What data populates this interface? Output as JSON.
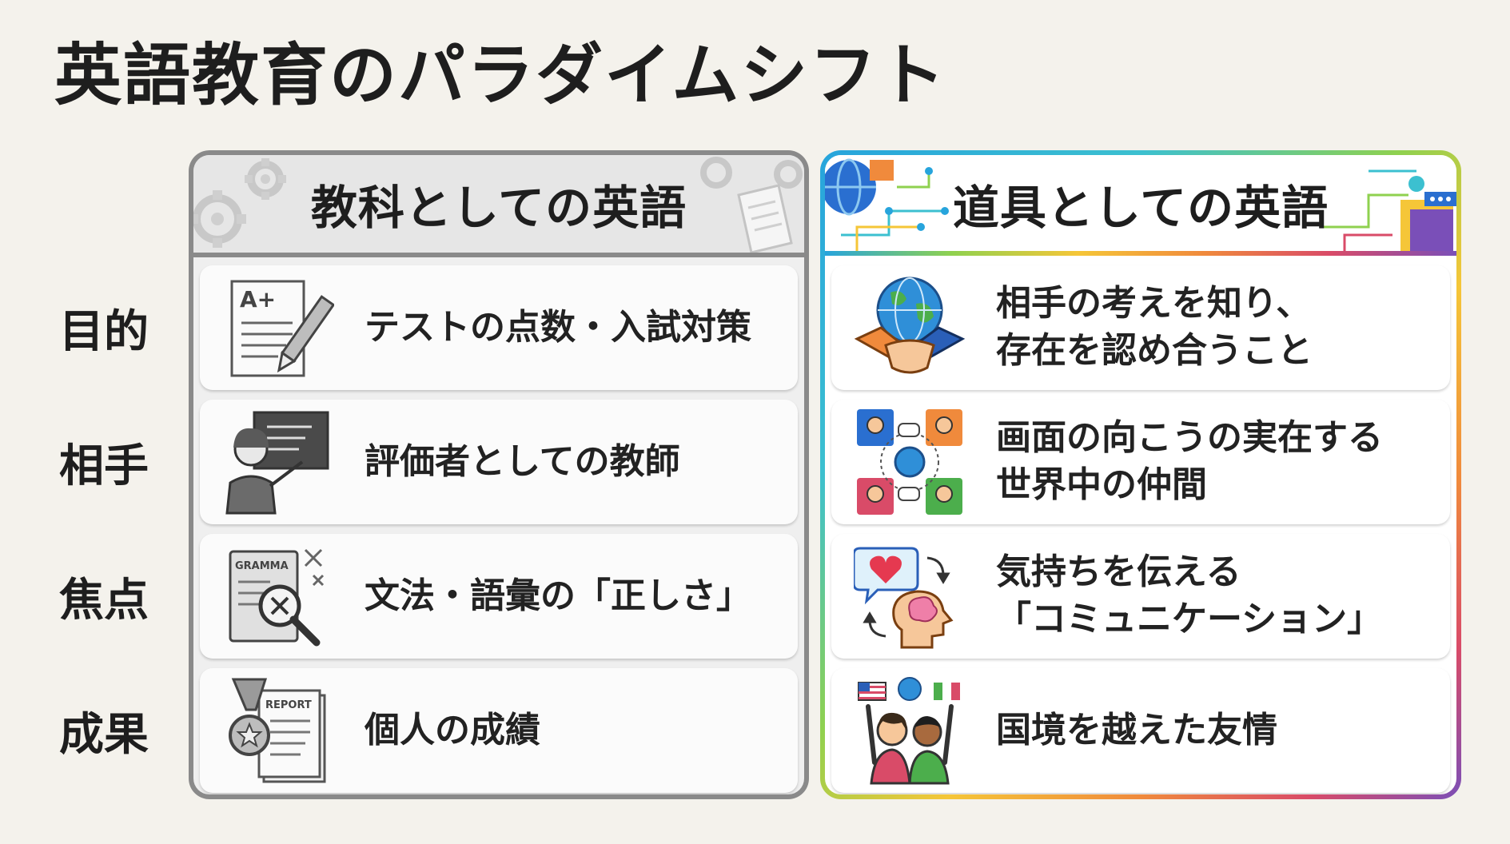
{
  "title": "英語教育のパラダイムシフト",
  "rows": [
    "目的",
    "相手",
    "焦点",
    "成果"
  ],
  "left": {
    "heading": "教科としての英語",
    "items": [
      {
        "text": [
          "テストの点数・入試対策"
        ],
        "icon": "graded-test-pencil-icon",
        "icon_text": "A+"
      },
      {
        "text": [
          "評価者としての教師"
        ],
        "icon": "teacher-blackboard-icon"
      },
      {
        "text": [
          "文法・語彙の「正しさ」"
        ],
        "icon": "grammar-book-magnifier-icon",
        "icon_text": "GRAMMA"
      },
      {
        "text": [
          "個人の成績"
        ],
        "icon": "medal-report-icon",
        "icon_text": "REPORT"
      }
    ]
  },
  "right": {
    "heading": "道具としての英語",
    "items": [
      {
        "text": [
          "相手の考えを知り、",
          "存在を認め合うこと"
        ],
        "icon": "globe-handshake-icon"
      },
      {
        "text": [
          "画面の向こうの実在する",
          "世界中の仲間"
        ],
        "icon": "global-video-chat-icon"
      },
      {
        "text": [
          "気持ちを伝える",
          "「コミュニケーション」"
        ],
        "icon": "heart-brain-communication-icon"
      },
      {
        "text": [
          "国境を越えた友情"
        ],
        "icon": "friends-flags-icon"
      }
    ]
  },
  "colors": {
    "background": "#f4f2ec",
    "left_border": "#8a8a8a",
    "right_gradient": [
      "#27a4dc",
      "#8fd14f",
      "#f5c638",
      "#f08a3c",
      "#d94b68",
      "#7a4fb8"
    ]
  }
}
